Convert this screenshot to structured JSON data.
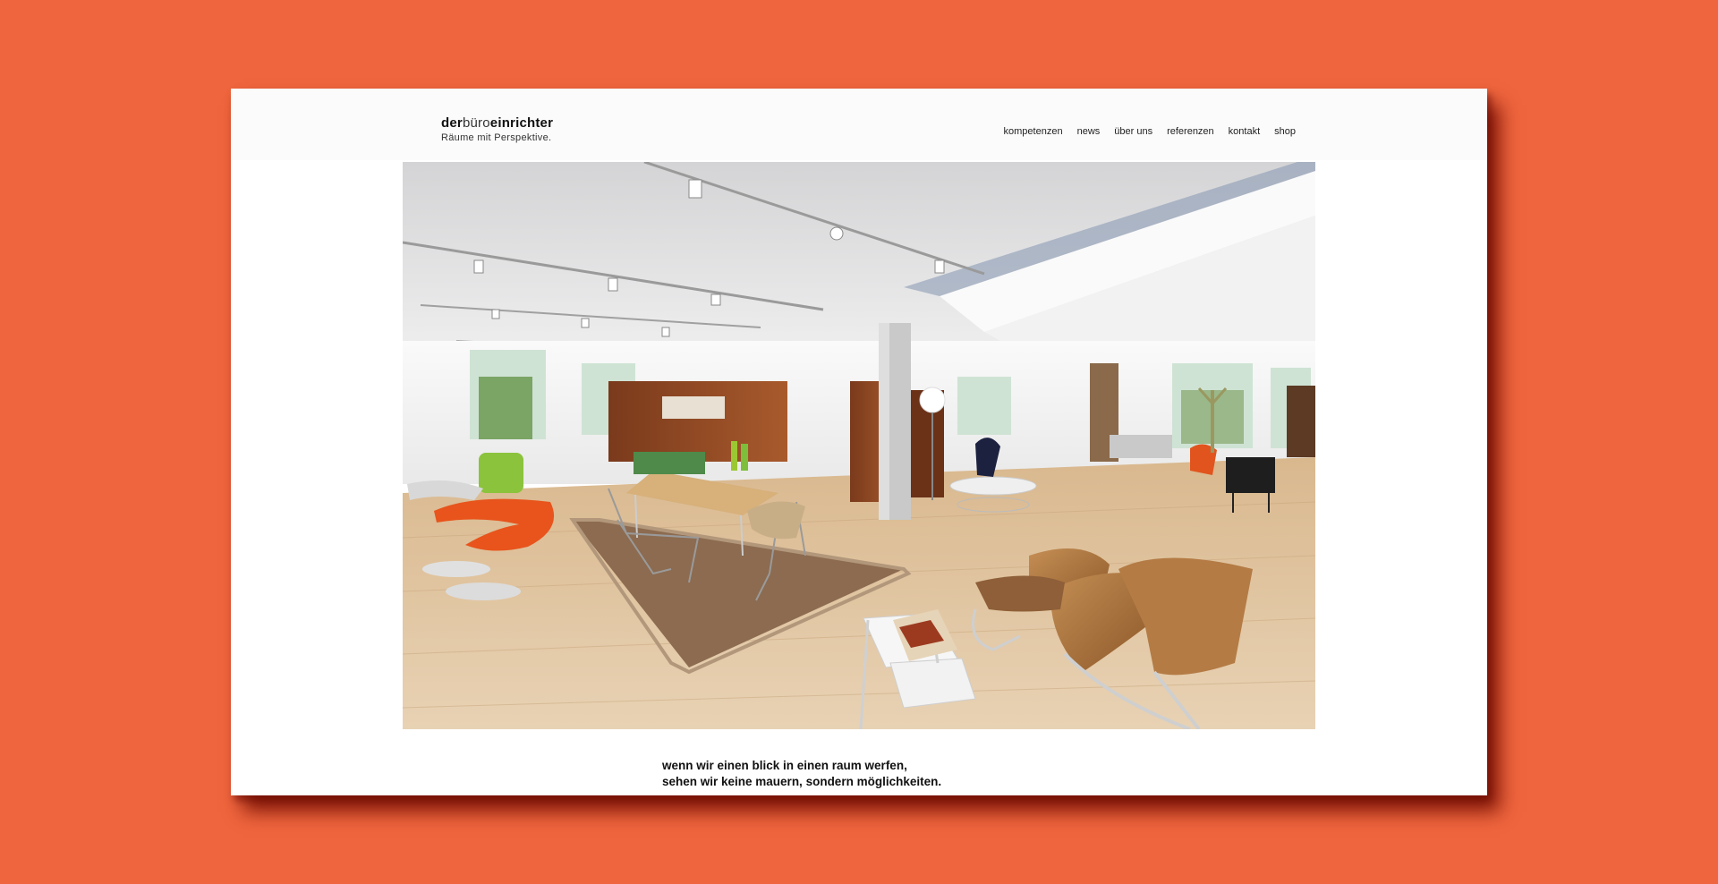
{
  "logo": {
    "part1": "der",
    "part2": "büro",
    "part3": "einrichter",
    "tagline": "Räume mit Perspektive."
  },
  "nav": {
    "items": [
      "kompetenzen",
      "news",
      "über uns",
      "referenzen",
      "kontakt",
      "shop"
    ]
  },
  "hero": {
    "image": "office-showroom-photo"
  },
  "intro": {
    "line1": "wenn wir einen blick in einen raum werfen,",
    "line2": "sehen wir keine mauern, sondern möglichkeiten."
  },
  "colors": {
    "background": "#ef653d",
    "page": "#ffffff"
  }
}
